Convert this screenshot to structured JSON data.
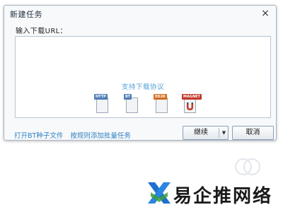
{
  "dialog": {
    "title": "新建任务",
    "close_label": "×",
    "url_label": "输入下载URL：",
    "url_value": "",
    "protocol_title": "支持下载协议",
    "protocols": [
      {
        "tag": "HTTP",
        "tag_color": "#4f7fb6",
        "icon": "http-document-icon"
      },
      {
        "tag": "BT",
        "tag_color": "#4f7fb6",
        "icon": "bt-document-icon"
      },
      {
        "tag": "ED2K",
        "tag_color": "#d46b1d",
        "icon": "ed2k-document-icon"
      },
      {
        "tag": "MAGNET",
        "tag_color": "#c0392b",
        "icon": "magnet-icon"
      }
    ],
    "links": {
      "open_bt": "打开BT种子文件",
      "batch_add": "按规则添加批量任务"
    },
    "buttons": {
      "continue": "继续",
      "dropdown": "▼",
      "cancel": "取消"
    }
  },
  "watermark": {
    "text": "易企推网络"
  },
  "colors": {
    "link": "#2f7fc1",
    "protocol_title": "#4ea1d6",
    "dialog_bg": "#f7f9fb",
    "dialog_border": "#a7b4c2",
    "watermark_blue": "#1f6fd0",
    "watermark_green": "#3aa03a"
  }
}
